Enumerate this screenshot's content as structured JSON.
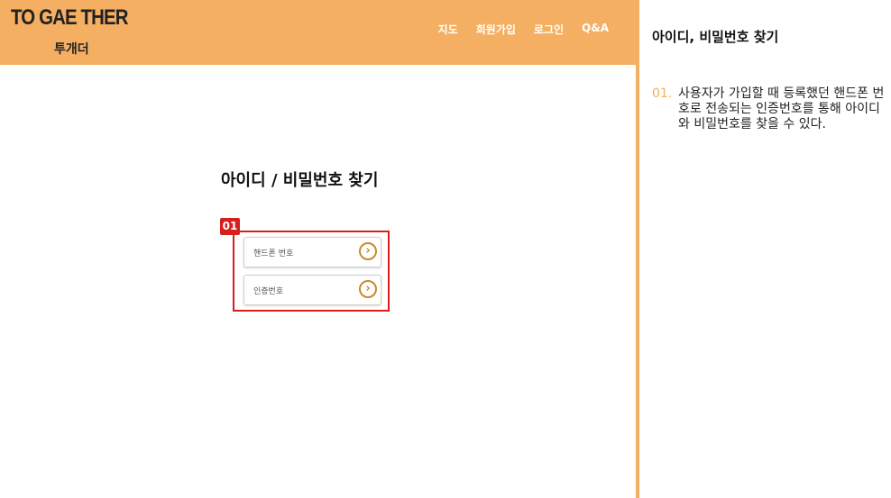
{
  "header": {
    "brand_title": "TO GAE THER",
    "brand_sub": "투개더",
    "nav": [
      "지도",
      "회원가입",
      "로그인",
      "Q&A"
    ]
  },
  "main": {
    "title": "아이디 / 비밀번호 찾기",
    "badge": "01",
    "fields": [
      {
        "placeholder": "핸드폰 번호",
        "button_icon": "chevron-right-icon"
      },
      {
        "placeholder": "인증번호",
        "button_icon": "chevron-right-icon"
      }
    ]
  },
  "panel": {
    "title": "아이디, 비밀번호 찾기",
    "notes": [
      {
        "num": "01.",
        "text": "사용자가 가입할 때 등록했던 핸드폰 번호로 전송되는 인증번호를 통해 아이디와 비밀번호를 찾을 수 있다."
      }
    ]
  },
  "colors": {
    "accent": "#f4af62",
    "highlight": "#d61f1f",
    "button": "#c98a2c"
  }
}
